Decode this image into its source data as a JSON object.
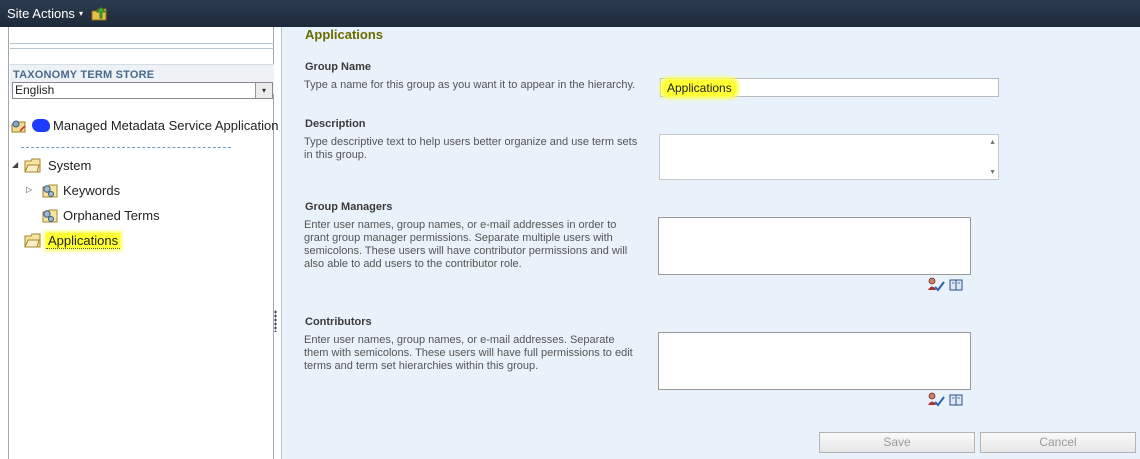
{
  "topbar": {
    "site_actions_label": "Site Actions",
    "site_actions_caret": "▾"
  },
  "left_panel": {
    "taxonomy_label": "TAXONOMY TERM STORE",
    "language": {
      "selected": "English",
      "arrow": "▾"
    },
    "service_application": "Managed Metadata Service Application",
    "tree": [
      {
        "label": "System",
        "toggle": "◢"
      },
      {
        "label": "Keywords",
        "toggle": "▷"
      },
      {
        "label": "Orphaned Terms"
      },
      {
        "label": "Applications"
      }
    ]
  },
  "form": {
    "title": "Applications",
    "group_name": {
      "title": "Group Name",
      "description": "Type a name for this group as you want it to appear in the hierarchy.",
      "value": "Applications"
    },
    "description": {
      "title": "Description",
      "description": "Type descriptive text to help users better organize and use term sets in this group.",
      "value": ""
    },
    "group_managers": {
      "title": "Group Managers",
      "description": "Enter user names, group names, or e-mail addresses in order to grant group manager permissions. Separate multiple users with semicolons. These users will have contributor permissions and will also able to add users to the contributor role.",
      "value": ""
    },
    "contributors": {
      "title": "Contributors",
      "description": "Enter user names, group names, or e-mail addresses. Separate them with semicolons. These users will have full permissions to edit terms and term set hierarchies within this group.",
      "value": ""
    },
    "buttons": {
      "save": "Save",
      "cancel": "Cancel"
    }
  },
  "colors": {
    "topbar": "#1f2d3e",
    "right_panel_bg": "#e9f1fb",
    "highlight": "#ffff33",
    "page_title": "#6b6b00"
  }
}
